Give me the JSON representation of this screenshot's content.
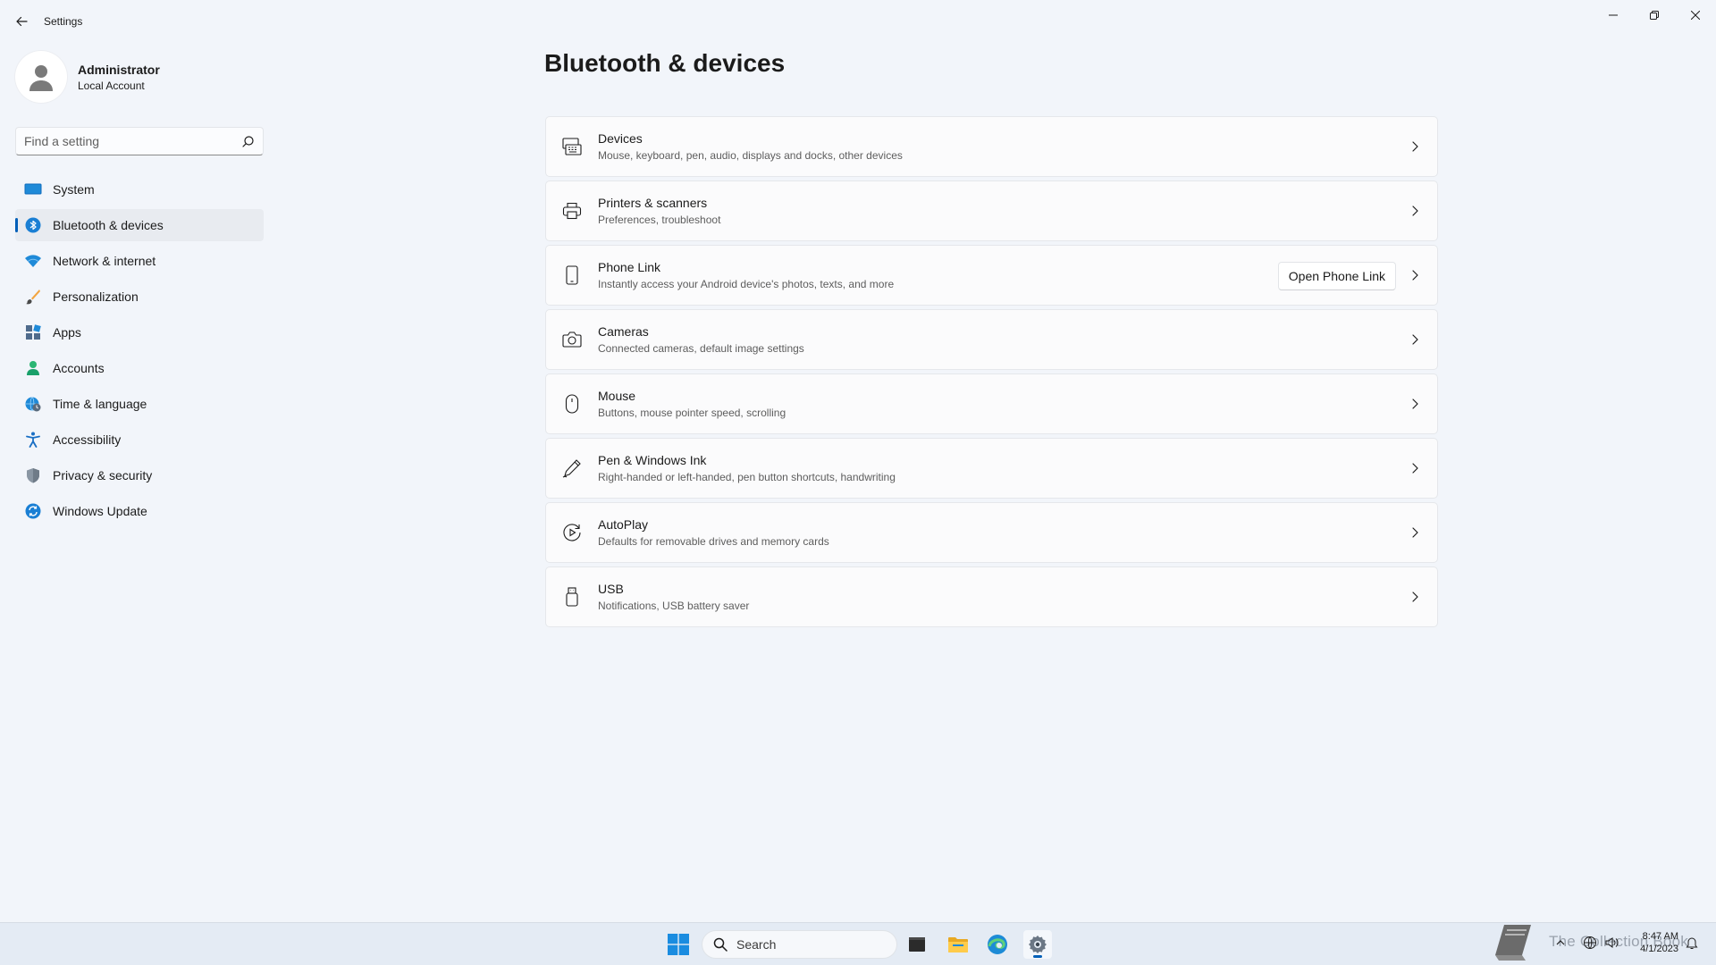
{
  "window": {
    "title": "Settings"
  },
  "profile": {
    "name": "Administrator",
    "account_type": "Local Account"
  },
  "search": {
    "placeholder": "Find a setting"
  },
  "nav": {
    "items": [
      {
        "label": "System",
        "icon": "display-icon",
        "selected": false
      },
      {
        "label": "Bluetooth & devices",
        "icon": "bluetooth-icon",
        "selected": true
      },
      {
        "label": "Network & internet",
        "icon": "wifi-icon",
        "selected": false
      },
      {
        "label": "Personalization",
        "icon": "brush-icon",
        "selected": false
      },
      {
        "label": "Apps",
        "icon": "apps-icon",
        "selected": false
      },
      {
        "label": "Accounts",
        "icon": "person-icon",
        "selected": false
      },
      {
        "label": "Time & language",
        "icon": "globe-clock-icon",
        "selected": false
      },
      {
        "label": "Accessibility",
        "icon": "accessibility-icon",
        "selected": false
      },
      {
        "label": "Privacy & security",
        "icon": "shield-icon",
        "selected": false
      },
      {
        "label": "Windows Update",
        "icon": "update-icon",
        "selected": false
      }
    ]
  },
  "page": {
    "title": "Bluetooth & devices"
  },
  "cards": [
    {
      "title": "Devices",
      "description": "Mouse, keyboard, pen, audio, displays and docks, other devices",
      "icon": "devices-icon"
    },
    {
      "title": "Printers & scanners",
      "description": "Preferences, troubleshoot",
      "icon": "printer-icon"
    },
    {
      "title": "Phone Link",
      "description": "Instantly access your Android device's photos, texts, and more",
      "icon": "phone-icon",
      "action_label": "Open Phone Link"
    },
    {
      "title": "Cameras",
      "description": "Connected cameras, default image settings",
      "icon": "camera-icon"
    },
    {
      "title": "Mouse",
      "description": "Buttons, mouse pointer speed, scrolling",
      "icon": "mouse-icon"
    },
    {
      "title": "Pen & Windows Ink",
      "description": "Right-handed or left-handed, pen button shortcuts, handwriting",
      "icon": "pen-icon"
    },
    {
      "title": "AutoPlay",
      "description": "Defaults for removable drives and memory cards",
      "icon": "autoplay-icon"
    },
    {
      "title": "USB",
      "description": "Notifications, USB battery saver",
      "icon": "usb-icon"
    }
  ],
  "taskbar": {
    "search_label": "Search",
    "apps": [
      "start-icon",
      "terminal-icon",
      "file-explorer-icon",
      "edge-icon",
      "settings-icon"
    ],
    "watermark_text": "The Collection Book",
    "time": "8:47 AM",
    "date": "4/1/2023"
  },
  "colors": {
    "accent": "#005fb8",
    "background": "#f2f5fa",
    "card": "#fbfbfc"
  }
}
